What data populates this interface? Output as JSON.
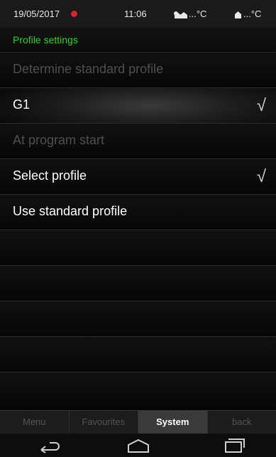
{
  "status": {
    "date": "19/05/2017",
    "time": "11:06",
    "temp_outside": "...°C",
    "temp_inside": "...°C",
    "alert_color": "#e0202a"
  },
  "header": {
    "title": "Profile settings",
    "title_color": "#27d427"
  },
  "list": {
    "determine_header": "Determine standard profile",
    "g1_label": "G1",
    "g1_checked": true,
    "program_start_header": "At program start",
    "select_profile_label": "Select profile",
    "select_profile_checked": true,
    "use_standard_label": "Use standard profile",
    "check_glyph": "√"
  },
  "tabs": {
    "menu": "Menu",
    "favourites": "Favourites",
    "system": "System",
    "back": "back",
    "active": "System"
  },
  "navigation": {
    "icons": [
      "back-arrow-icon",
      "home-icon",
      "recent-apps-icon"
    ]
  }
}
